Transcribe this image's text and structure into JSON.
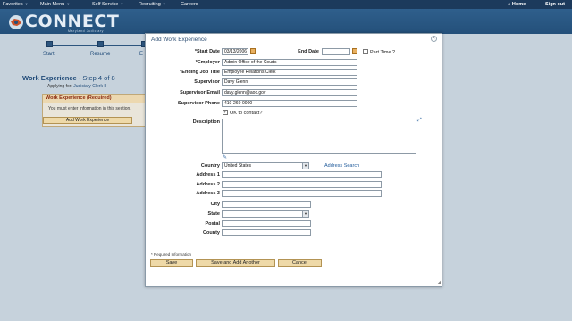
{
  "menu": {
    "items": [
      "Favorites",
      "Main Menu",
      "Self Service",
      "Recruiting",
      "Careers"
    ],
    "home_label": "Home",
    "signout_label": "Sign out"
  },
  "header": {
    "logo_text": "CONNECT",
    "logo_sub": "Maryland Judiciary"
  },
  "background": {
    "steps": [
      "Start",
      "Resume",
      "E"
    ],
    "title": "Work Experience",
    "step_info": " - Step 4 of 8",
    "applying_prefix": "Applying for:",
    "applying_job": "Judiciary Clerk II",
    "section_title": "Work Experience (Required)",
    "section_message": "You must enter information in this section.",
    "add_button": "Add Work Experience"
  },
  "modal": {
    "title": "Add Work Experience",
    "close_icon": "close-icon",
    "fields": {
      "start_date": {
        "label": "*Start Date",
        "value": "03/13/2006"
      },
      "end_date": {
        "label": "End Date",
        "value": ""
      },
      "part_time": {
        "label": "Part Time ?",
        "checked": false
      },
      "employer": {
        "label": "*Employer",
        "value": "Admin Office of the Courts"
      },
      "ending_job_title": {
        "label": "*Ending Job Title",
        "value": "Employee Relations Clerk"
      },
      "supervisor": {
        "label": "Supervisor",
        "value": "Davy Glenn"
      },
      "supervisor_email": {
        "label": "Supervisor Email",
        "value": "davy.glenn@aoc.gov"
      },
      "supervisor_phone": {
        "label": "Supervisor Phone",
        "value": "410-260-0000"
      },
      "ok_to_contact": {
        "label": "OK to contact?",
        "checked": true
      },
      "description": {
        "label": "Description",
        "value": ""
      },
      "country": {
        "label": "Country",
        "value": "United States"
      },
      "address_search": "Address Search",
      "address1": {
        "label": "Address 1",
        "value": ""
      },
      "address2": {
        "label": "Address 2",
        "value": ""
      },
      "address3": {
        "label": "Address 3",
        "value": ""
      },
      "city": {
        "label": "City",
        "value": ""
      },
      "state": {
        "label": "State",
        "value": ""
      },
      "postal": {
        "label": "Postal",
        "value": ""
      },
      "county": {
        "label": "County",
        "value": ""
      }
    },
    "required_note": "* Required Information",
    "buttons": {
      "save": "Save",
      "save_add": "Save and Add Another",
      "cancel": "Cancel"
    }
  },
  "colors": {
    "topbar": "#1c3a5c",
    "header": "#2f5f8c",
    "button": "#eed9a8",
    "required_heading": "#8a2a10"
  }
}
